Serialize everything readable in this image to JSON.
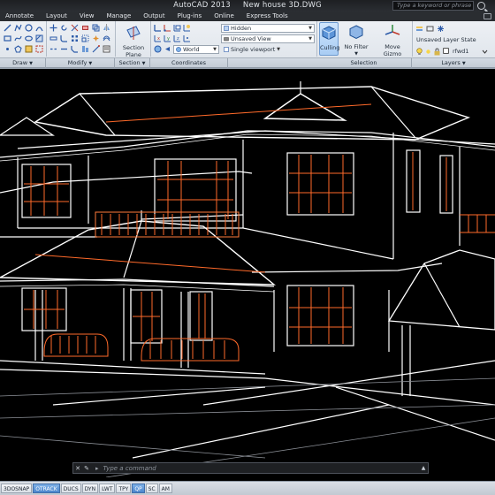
{
  "app": {
    "title": "AutoCAD 2013",
    "document": "New house 3D.DWG",
    "search_placeholder": "Type a keyword or phrase"
  },
  "menu": {
    "tabs": [
      "Annotate",
      "Layout",
      "View",
      "Manage",
      "Output",
      "Plug-ins",
      "Online",
      "Express Tools"
    ]
  },
  "ribbon": {
    "panels": {
      "draw": "Draw",
      "modify": "Modify",
      "section": "Section",
      "coordinates": "Coordinates",
      "selection": "Selection",
      "layers": "Layers"
    },
    "section_plane": "Section Plane",
    "visual_style": "Hidden",
    "view": "Unsaved View",
    "ucs": "World",
    "viewport": "Single viewport",
    "culling": "Culling",
    "filter": "No Filter",
    "gizmo": "Move Gizmo",
    "layer_state": "Unsaved Layer State",
    "layer": "rfwd1"
  },
  "command_line": {
    "prompt": "Type a command"
  },
  "status_bar": {
    "buttons": [
      {
        "label": "3DOSNAP",
        "on": false
      },
      {
        "label": "OTRACK",
        "on": true
      },
      {
        "label": "DUCS",
        "on": false
      },
      {
        "label": "DYN",
        "on": false
      },
      {
        "label": "LWT",
        "on": false
      },
      {
        "label": "TPY",
        "on": false
      },
      {
        "label": "QP",
        "on": true
      },
      {
        "label": "SC",
        "on": false
      },
      {
        "label": "AM",
        "on": false
      }
    ]
  },
  "colors": {
    "accent": "#4c86cc",
    "wireframe_white": "#ffffff",
    "wireframe_orange": "#ff6a2a",
    "viewport_bg": "#000000"
  }
}
